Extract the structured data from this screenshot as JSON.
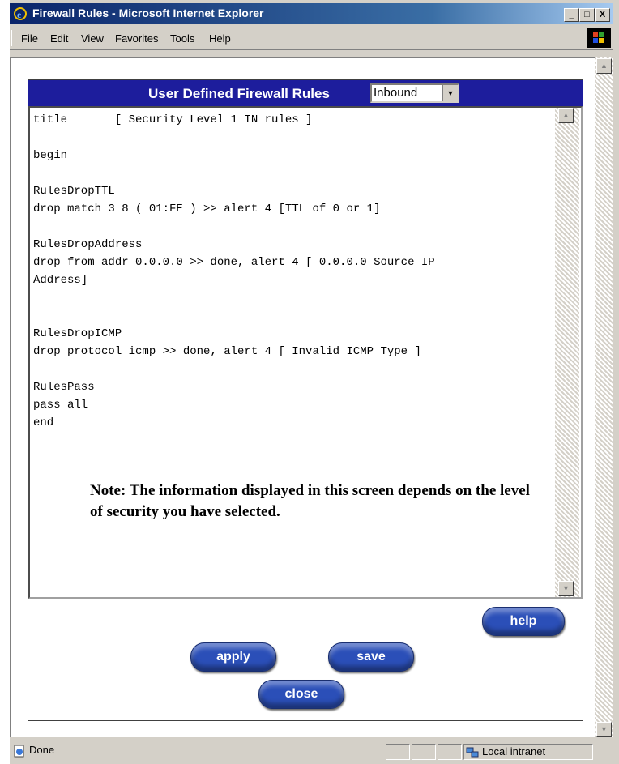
{
  "window": {
    "title": "Firewall Rules - Microsoft Internet Explorer",
    "controls": [
      "_",
      "□",
      "X"
    ]
  },
  "menu": [
    "File",
    "Edit",
    "View",
    "Favorites",
    "Tools",
    "Help"
  ],
  "panel": {
    "title": "User Defined Firewall Rules",
    "direction_select": {
      "selected": "Inbound",
      "arrow": "▼"
    }
  },
  "rules_lines": [
    "title       [ Security Level 1 IN rules ]",
    "",
    "begin",
    "",
    "RulesDropTTL",
    "drop match 3 8 ( 01:FE ) >> alert 4 [TTL of 0 or 1]",
    "",
    "RulesDropAddress",
    "drop from addr 0.0.0.0 >> done, alert 4 [ 0.0.0.0 Source IP",
    "Address]",
    "",
    "",
    "RulesDropICMP",
    "drop protocol icmp >> done, alert 4 [ Invalid ICMP Type ]",
    "",
    "RulesPass",
    "pass all",
    "end"
  ],
  "note": "Note: The information displayed in this screen depends on the level of security you have selected.",
  "buttons": {
    "help": "help",
    "apply": "apply",
    "save": "save",
    "close": "close"
  },
  "status": {
    "left": "Done",
    "zone": "Local intranet"
  },
  "icons": [
    "ie-icon",
    "windows-logo-icon",
    "scroll-up-arrow-icon",
    "scroll-down-arrow-icon",
    "dropdown-arrow-icon",
    "page-icon",
    "intranet-icon"
  ]
}
